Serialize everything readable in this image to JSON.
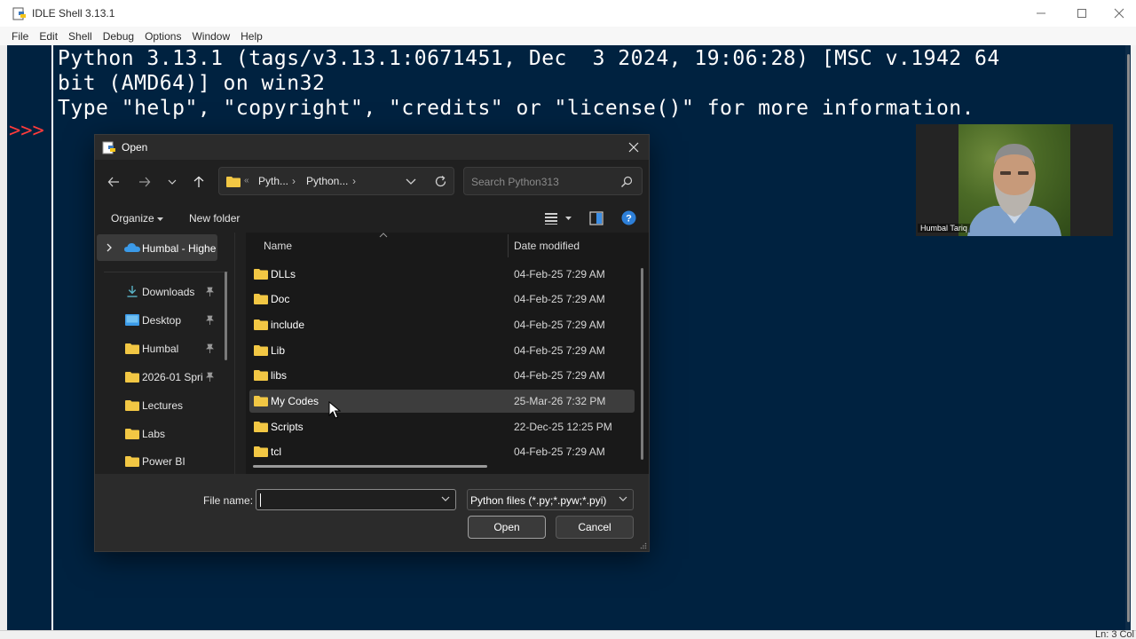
{
  "window": {
    "title": "IDLE Shell 3.13.1"
  },
  "menu": [
    "File",
    "Edit",
    "Shell",
    "Debug",
    "Options",
    "Window",
    "Help"
  ],
  "shell": {
    "lines": [
      "Python 3.13.1 (tags/v3.13.1:0671451, Dec  3 2024, 19:06:28) [MSC v.1942 64",
      "bit (AMD64)] on win32",
      "Type \"help\", \"copyright\", \"credits\" or \"license()\" for more information."
    ],
    "prompt": ">>>"
  },
  "status": {
    "text": "Ln: 3  Col"
  },
  "dialog": {
    "title": "Open",
    "breadcrumb": [
      "Pyth...",
      "Python..."
    ],
    "search_placeholder": "Search Python313",
    "commands": {
      "organize": "Organize",
      "new_folder": "New folder"
    },
    "nav_items": [
      {
        "label": "Humbal - Highe",
        "icon": "onedrive-icon"
      },
      {
        "label": "Downloads",
        "icon": "download-icon",
        "pinned": true
      },
      {
        "label": "Desktop",
        "icon": "desktop-icon",
        "pinned": true
      },
      {
        "label": "Humbal",
        "icon": "folder-icon",
        "pinned": true
      },
      {
        "label": "2026-01 Spri",
        "icon": "folder-icon",
        "pinned": true
      },
      {
        "label": "Lectures",
        "icon": "folder-icon"
      },
      {
        "label": "Labs",
        "icon": "folder-icon"
      },
      {
        "label": "Power BI",
        "icon": "folder-icon"
      }
    ],
    "columns": {
      "name": "Name",
      "date": "Date modified"
    },
    "files": [
      {
        "name": "DLLs",
        "date": "04-Feb-25 7:29 AM"
      },
      {
        "name": "Doc",
        "date": "04-Feb-25 7:29 AM"
      },
      {
        "name": "include",
        "date": "04-Feb-25 7:29 AM"
      },
      {
        "name": "Lib",
        "date": "04-Feb-25 7:29 AM"
      },
      {
        "name": "libs",
        "date": "04-Feb-25 7:29 AM"
      },
      {
        "name": "My Codes",
        "date": "25-Mar-26 7:32 PM",
        "selected": true
      },
      {
        "name": "Scripts",
        "date": "22-Dec-25 12:25 PM"
      },
      {
        "name": "tcl",
        "date": "04-Feb-25 7:29 AM"
      }
    ],
    "file_name_label": "File name:",
    "file_name_value": "",
    "file_type": "Python files (*.py;*.pyw;*.pyi)",
    "open_label": "Open",
    "cancel_label": "Cancel"
  },
  "webcam": {
    "name": "Humbal Tariq"
  },
  "colors": {
    "shell_bg": "#002240",
    "prompt": "#ff3b3b",
    "folder": "#f2c744",
    "dialog_bg": "#202020"
  }
}
